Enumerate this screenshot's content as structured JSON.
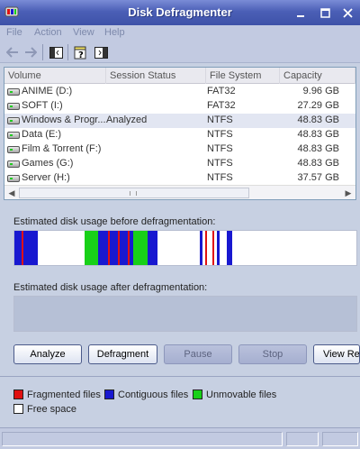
{
  "window": {
    "title": "Disk Defragmenter",
    "icons": {
      "app": "defrag-app-icon",
      "minimize": "minimize-icon",
      "maximize": "maximize-icon",
      "close": "close-icon"
    }
  },
  "menu": {
    "items": [
      {
        "label": "File"
      },
      {
        "label": "Action"
      },
      {
        "label": "View"
      },
      {
        "label": "Help"
      }
    ]
  },
  "toolbar": {
    "icons": [
      "back-arrow-icon",
      "forward-arrow-icon",
      "console-tree-icon",
      "help-icon",
      "show-hide-icon"
    ]
  },
  "volumes": {
    "columns": [
      "Volume",
      "Session Status",
      "File System",
      "Capacity"
    ],
    "rows": [
      {
        "volume": "ANIME (D:)",
        "status": "",
        "fs": "FAT32",
        "capacity": "9.96 GB"
      },
      {
        "volume": "SOFT (I:)",
        "status": "",
        "fs": "FAT32",
        "capacity": "27.29 GB"
      },
      {
        "volume": "Windows & Progr...",
        "status": "Analyzed",
        "fs": "NTFS",
        "capacity": "48.83 GB"
      },
      {
        "volume": "Data (E:)",
        "status": "",
        "fs": "NTFS",
        "capacity": "48.83 GB"
      },
      {
        "volume": "Film & Torrent (F:)",
        "status": "",
        "fs": "NTFS",
        "capacity": "48.83 GB"
      },
      {
        "volume": "Games (G:)",
        "status": "",
        "fs": "NTFS",
        "capacity": "48.83 GB"
      },
      {
        "volume": "Server (H:)",
        "status": "",
        "fs": "NTFS",
        "capacity": "37.57 GB"
      }
    ],
    "selected_index": 2
  },
  "usage": {
    "before_label": "Estimated disk usage before defragmentation:",
    "after_label": "Estimated disk usage after defragmentation:"
  },
  "buttons": {
    "analyze": "Analyze",
    "defragment": "Defragment",
    "pause": "Pause",
    "stop": "Stop",
    "view_report": "View Rep"
  },
  "legend": {
    "fragmented": {
      "label": "Fragmented files",
      "color": "#e01010"
    },
    "contiguous": {
      "label": "Contiguous files",
      "color": "#1818d0"
    },
    "unmovable": {
      "label": "Unmovable files",
      "color": "#18d018"
    },
    "free": {
      "label": "Free space",
      "color": "#ffffff"
    }
  }
}
